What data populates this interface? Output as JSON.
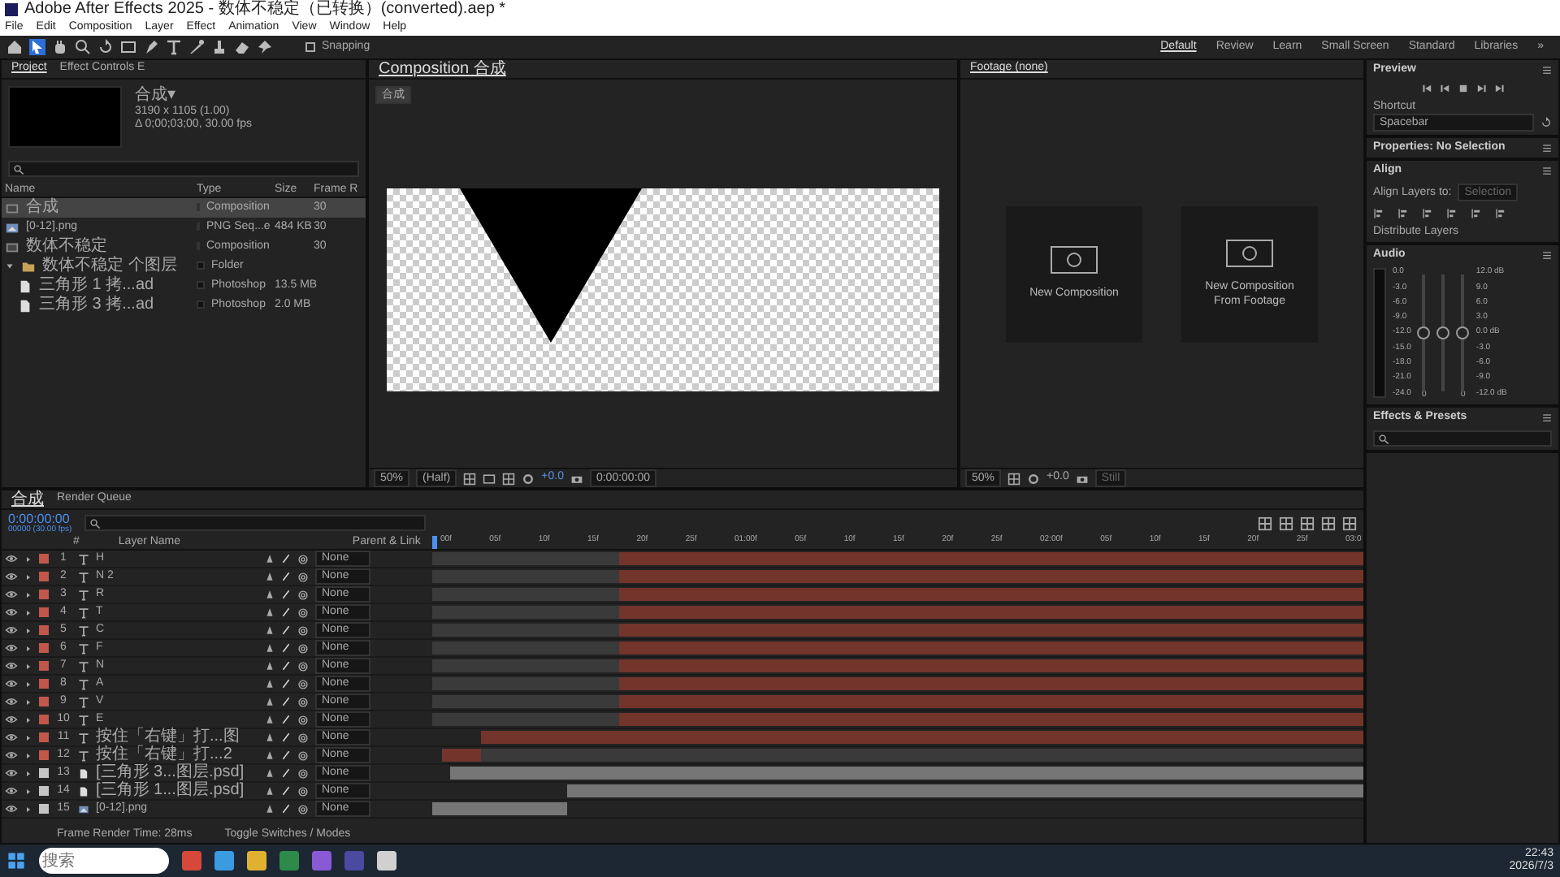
{
  "window": {
    "title": "Adobe After Effects 2025 - 数体不稳定（已转换）(converted).aep *"
  },
  "menu": [
    "File",
    "Edit",
    "Composition",
    "Layer",
    "Effect",
    "Animation",
    "View",
    "Window",
    "Help"
  ],
  "toolbar": {
    "snapping": {
      "label": "Snapping",
      "checked": false
    }
  },
  "workspaces": [
    {
      "label": "Default",
      "selected": true
    },
    {
      "label": "Review",
      "selected": false
    },
    {
      "label": "Learn",
      "selected": false
    },
    {
      "label": "Small Screen",
      "selected": false
    },
    {
      "label": "Standard",
      "selected": false
    },
    {
      "label": "Libraries",
      "selected": false
    },
    {
      "label": "»",
      "selected": false
    }
  ],
  "project": {
    "tabs": [
      {
        "label": "Project",
        "selected": true
      },
      {
        "label": "Effect Controls E",
        "selected": false
      }
    ],
    "comp_name": "合成▾",
    "comp_info": [
      "3190 x 1105 (1.00)",
      "Δ 0;00;03;00, 30.00 fps"
    ],
    "columns": [
      "Name",
      "Type",
      "Size",
      "Frame R"
    ],
    "items": [
      {
        "name": "合成",
        "type": "Composition",
        "frame_rate": "30",
        "kind": "comp",
        "selected": true
      },
      {
        "name": "[0-12].png",
        "type": "PNG Seq...e",
        "size": "484 KB",
        "frame_rate": "30",
        "kind": "image",
        "selected": false
      },
      {
        "name": "数体不稳定",
        "type": "Composition",
        "frame_rate": "30",
        "kind": "comp",
        "selected": false
      },
      {
        "name": "数体不稳定 个图层",
        "type": "Folder",
        "kind": "folder",
        "selected": false,
        "expanded": true,
        "children": [
          {
            "name": "三角形 1 拷...ad",
            "type": "Photoshop",
            "size": "13.5 MB",
            "kind": "psd",
            "selected": false
          },
          {
            "name": "三角形 3 拷...ad",
            "type": "Photoshop",
            "size": "2.0 MB",
            "kind": "psd",
            "selected": false
          }
        ]
      }
    ]
  },
  "composition": {
    "tab": "Composition 合成",
    "breadcrumb": "合成",
    "zoom": "50%",
    "resolution": "(Half)",
    "exposure": "+0.0",
    "timecode": "0:00:00:00"
  },
  "footage": {
    "tab": "Footage (none)",
    "cards": [
      {
        "lines": [
          "New Composition"
        ]
      },
      {
        "lines": [
          "New Composition",
          "From Footage"
        ]
      }
    ],
    "zoom": "50%",
    "exposure": "+0.0",
    "view": "Still"
  },
  "right": {
    "preview": {
      "title": "Preview",
      "shortcut_label": "Shortcut",
      "shortcut": "Spacebar"
    },
    "properties": {
      "title": "Properties: No Selection"
    },
    "align": {
      "title": "Align",
      "align_to_label": "Align Layers to:",
      "align_to": "Selection",
      "distribute": "Distribute Layers"
    },
    "audio": {
      "title": "Audio",
      "left_scale": [
        "0.0",
        "-3.0",
        "-6.0",
        "-9.0",
        "-12.0",
        "-15.0",
        "-18.0",
        "-21.0",
        "-24.0"
      ],
      "right_scale": [
        "12.0 dB",
        "9.0",
        "6.0",
        "3.0",
        "0.0 dB",
        "-3.0",
        "-6.0",
        "-9.0",
        "-12.0 dB"
      ],
      "sliders": [
        {
          "level": 0.5,
          "reading": "0"
        },
        {
          "level": 0.5
        },
        {
          "level": 0.5,
          "reading": "0"
        }
      ]
    },
    "effects": {
      "title": "Effects & Presets"
    }
  },
  "timeline": {
    "tabs": [
      {
        "label": "合成",
        "selected": true
      },
      {
        "label": "Render Queue",
        "selected": false
      }
    ],
    "timecode": "0:00:00:00",
    "frames": "00000 (30.00 fps)",
    "columns": [
      "#",
      "Layer Name",
      "Parent & Link"
    ],
    "layers": [
      {
        "number": "1",
        "name": "H",
        "kind": "text",
        "color": "#c0574a",
        "parent": "None"
      },
      {
        "number": "2",
        "name": "N 2",
        "kind": "text",
        "color": "#c0574a",
        "parent": "None"
      },
      {
        "number": "3",
        "name": "R",
        "kind": "text",
        "color": "#c0574a",
        "parent": "None"
      },
      {
        "number": "4",
        "name": "T",
        "kind": "text",
        "color": "#c0574a",
        "parent": "None"
      },
      {
        "number": "5",
        "name": "C",
        "kind": "text",
        "color": "#c0574a",
        "parent": "None"
      },
      {
        "number": "6",
        "name": "F",
        "kind": "text",
        "color": "#c0574a",
        "parent": "None"
      },
      {
        "number": "7",
        "name": "N",
        "kind": "text",
        "color": "#c0574a",
        "parent": "None"
      },
      {
        "number": "8",
        "name": "A",
        "kind": "text",
        "color": "#c0574a",
        "parent": "None"
      },
      {
        "number": "9",
        "name": "V",
        "kind": "text",
        "color": "#c0574a",
        "parent": "None"
      },
      {
        "number": "10",
        "name": "E",
        "kind": "text",
        "color": "#c0574a",
        "parent": "None"
      },
      {
        "number": "11",
        "name": "按住「右键」打...图",
        "kind": "text",
        "color": "#c0574a",
        "parent": "None"
      },
      {
        "number": "12",
        "name": "按住「右键」打...2",
        "kind": "text",
        "color": "#c0574a",
        "parent": "None"
      },
      {
        "number": "13",
        "name": "[三角形 3...图层.psd]",
        "kind": "footage",
        "color": "#c4c4c4",
        "parent": "None"
      },
      {
        "number": "14",
        "name": "[三角形 1...图层.psd]",
        "kind": "footage",
        "color": "#c4c4c4",
        "parent": "None"
      },
      {
        "number": "15",
        "name": "[0-12].png",
        "kind": "image",
        "color": "#c4c4c4",
        "parent": "None"
      }
    ],
    "ruler": [
      "00f",
      "05f",
      "10f",
      "15f",
      "20f",
      "25f",
      "01:00f",
      "05f",
      "10f",
      "15f",
      "20f",
      "25f",
      "02:00f",
      "05f",
      "10f",
      "15f",
      "20f",
      "25f",
      "03:0"
    ],
    "footer": {
      "render_time": "Frame Render Time: 28ms",
      "toggle": "Toggle Switches / Modes"
    }
  },
  "taskbar": {
    "search_placeholder": "搜索",
    "time": "22:43",
    "date": "2026/7/3"
  }
}
